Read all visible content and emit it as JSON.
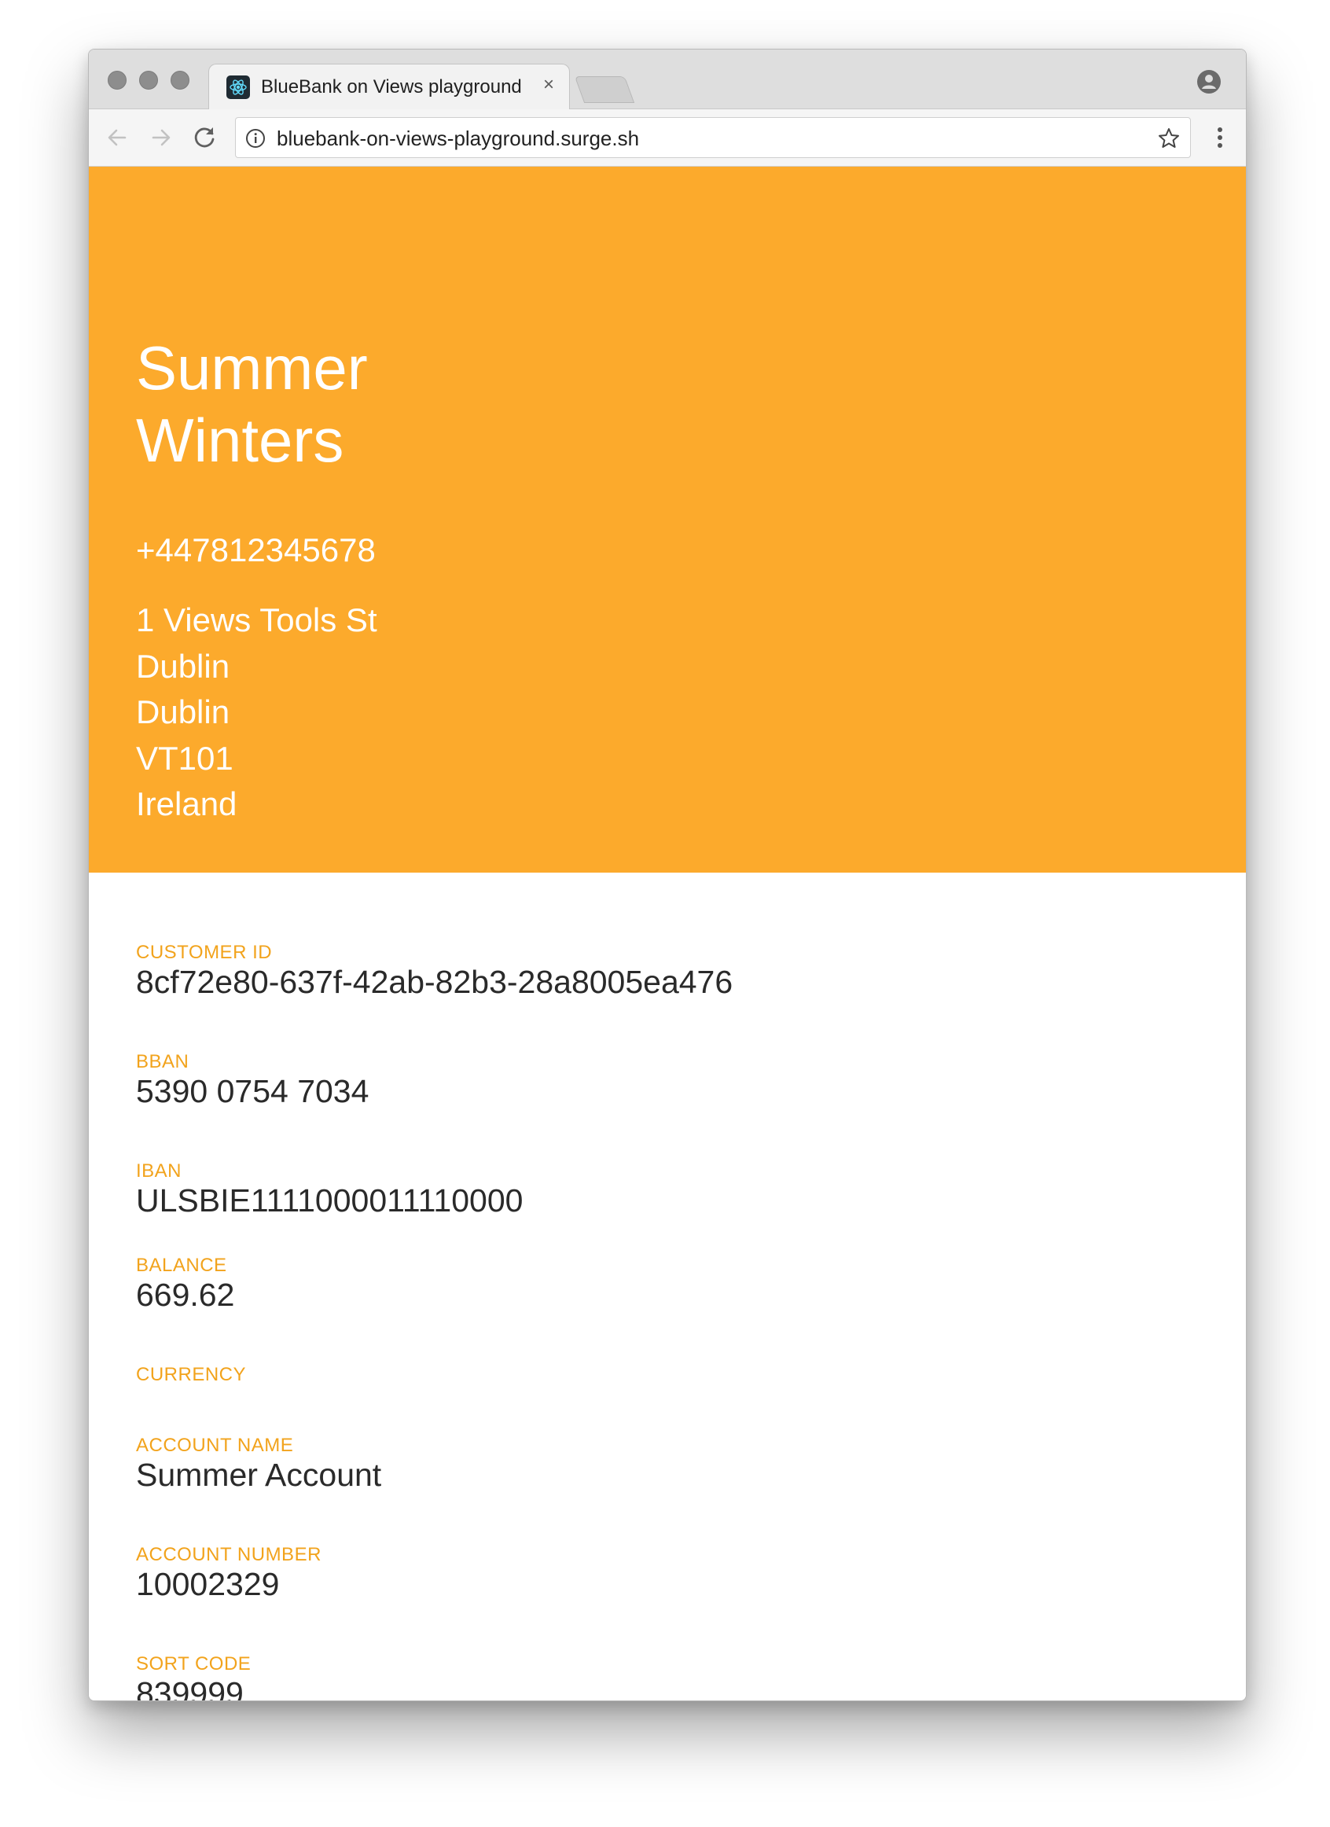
{
  "browser": {
    "tab_title": "BlueBank on Views playground",
    "tab_close": "×",
    "url": "bluebank-on-views-playground.surge.sh"
  },
  "colors": {
    "hero_background": "#fcaa2c",
    "label": "#f2a31c",
    "value": "#2a2a2a"
  },
  "icons": [
    "react-favicon-icon",
    "close-icon",
    "profile-icon",
    "back-arrow-icon",
    "forward-arrow-icon",
    "reload-icon",
    "info-icon",
    "star-icon",
    "more-vertical-icon"
  ],
  "customer": {
    "name_first": "Summer",
    "name_last": "Winters",
    "phone": "+447812345678",
    "address": [
      "1 Views Tools St",
      "Dublin",
      "Dublin",
      "VT101",
      "Ireland"
    ]
  },
  "fields": [
    {
      "label": "CUSTOMER ID",
      "value": "8cf72e80-637f-42ab-82b3-28a8005ea476"
    },
    {
      "label": "BBAN",
      "value": "5390 0754 7034"
    },
    {
      "label": "IBAN",
      "value": "ULSBIE1111000011110000"
    },
    {
      "label": "BALANCE",
      "value": "669.62"
    },
    {
      "label": "CURRENCY",
      "value": ""
    },
    {
      "label": "ACCOUNT NAME",
      "value": "Summer Account"
    },
    {
      "label": "ACCOUNT NUMBER",
      "value": "10002329"
    },
    {
      "label": "SORT CODE",
      "value": "839999"
    }
  ]
}
